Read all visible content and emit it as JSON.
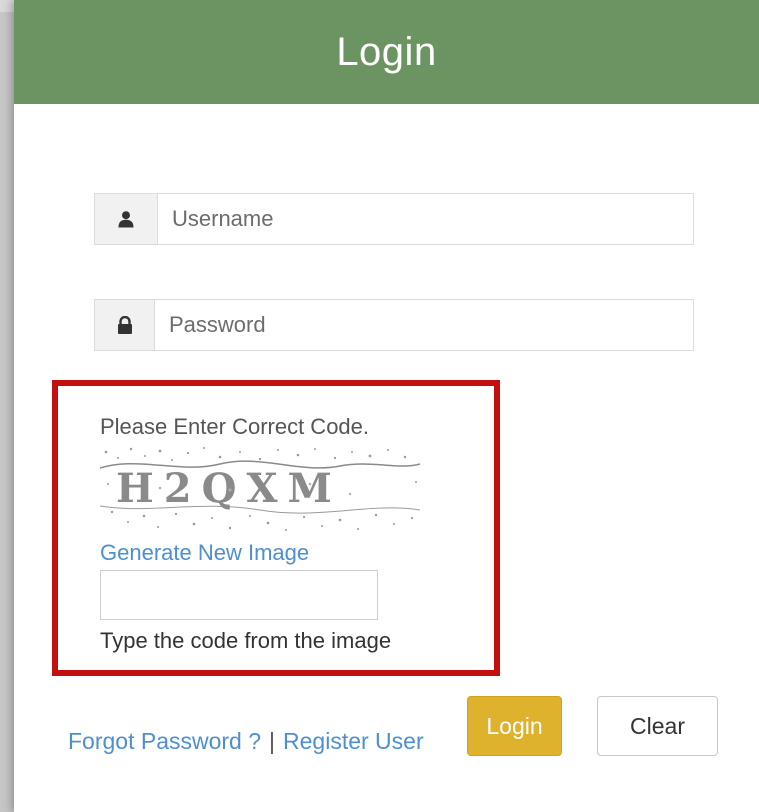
{
  "header": {
    "title": "Login"
  },
  "form": {
    "username": {
      "placeholder": "Username",
      "value": "",
      "icon": "user-icon"
    },
    "password": {
      "placeholder": "Password",
      "value": "",
      "icon": "lock-icon"
    }
  },
  "captcha": {
    "prompt": "Please Enter Correct Code.",
    "code_text": "H2QXM",
    "generate_link": "Generate New Image",
    "input_value": "",
    "hint": "Type the code from the image"
  },
  "footer": {
    "forgot_password": "Forgot Password ?",
    "separator": "|",
    "register": "Register User",
    "login_button": "Login",
    "clear_button": "Clear"
  },
  "colors": {
    "header_bg": "#6b9462",
    "highlight_border": "#c40f0f",
    "link": "#4e8fcf",
    "login_button": "#dfb22d"
  }
}
